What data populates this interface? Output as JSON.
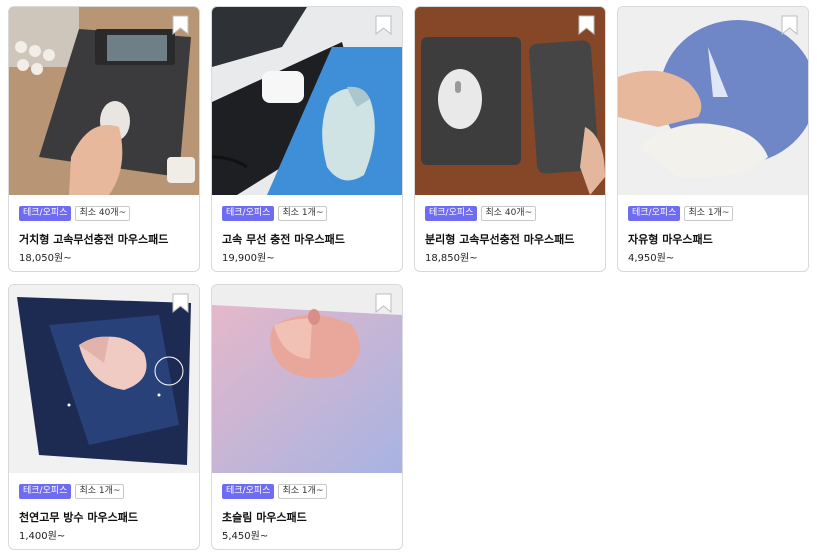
{
  "products": [
    {
      "category": "테크/오피스",
      "min_order": "최소 40개~",
      "name": "거치형 고속무선충전 마우스패드",
      "price": "18,050원~",
      "image": "pad-with-phone-stand"
    },
    {
      "category": "테크/오피스",
      "min_order": "최소 1개~",
      "name": "고속 무선 충전 마우스패드",
      "price": "19,900원~",
      "image": "blue-black-pad-with-earbuds"
    },
    {
      "category": "테크/오피스",
      "min_order": "최소 40개~",
      "name": "분리형 고속무선충전 마우스패드",
      "price": "18,850원~",
      "image": "gray-pad-on-wood"
    },
    {
      "category": "테크/오피스",
      "min_order": "최소 1개~",
      "name": "자유형 마우스패드",
      "price": "4,950원~",
      "image": "round-blue-pad"
    },
    {
      "category": "테크/오피스",
      "min_order": "최소 1개~",
      "name": "천연고무 방수 마우스패드",
      "price": "1,400원~",
      "image": "galaxy-pad"
    },
    {
      "category": "테크/오피스",
      "min_order": "최소 1개~",
      "name": "초슬림 마우스패드",
      "price": "5,450원~",
      "image": "pink-lilac-pad"
    }
  ],
  "colors": {
    "accent": "#6f6cf4",
    "border": "#d9d9d9"
  }
}
